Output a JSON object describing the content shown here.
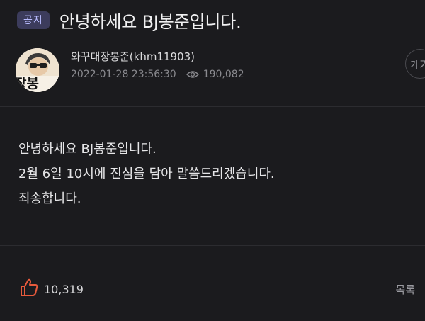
{
  "header": {
    "badge_label": "공지",
    "title": "안녕하세요 BJ봉준입니다."
  },
  "author": {
    "name": "와꾸대장봉준(khm11903)",
    "avatar_text": "장봉",
    "date": "2022-01-28 23:56:30",
    "views": "190,082",
    "font_button_small": "가",
    "font_button_big": "가"
  },
  "body": {
    "lines": [
      "안녕하세요 BJ봉준입니다.",
      "2월 6일 10시에 진심을 담아 말씀드리겠습니다.",
      "죄송합니다."
    ]
  },
  "footer": {
    "like_count": "10,319",
    "list_label": "목록"
  },
  "icons": {
    "eye": "eye-icon",
    "thumbs_up": "thumbs-up-icon",
    "font_size": "font-size-icon"
  },
  "colors": {
    "background": "#1b1b1e",
    "badge_bg": "#3c3c5c",
    "badge_text": "#b9bcff",
    "like_icon": "#e85a3c",
    "meta_text": "#8a8a8f"
  }
}
